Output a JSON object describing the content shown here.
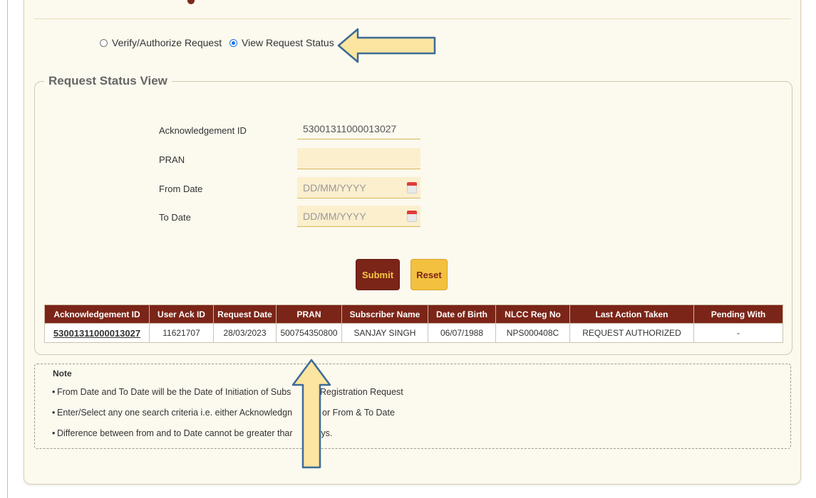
{
  "radio": {
    "options": [
      {
        "label": "Verify/Authorize Request",
        "selected": false
      },
      {
        "label": "View Request Status",
        "selected": true
      }
    ]
  },
  "section": {
    "title": "Request Status View"
  },
  "form": {
    "ack_id_label": "Acknowledgement ID",
    "ack_id_value": "53001311000013027",
    "pran_label": "PRAN",
    "pran_value": "",
    "from_date_label": "From Date",
    "from_date_placeholder": "DD/MM/YYYY",
    "to_date_label": "To Date",
    "to_date_placeholder": "DD/MM/YYYY",
    "calendar_icon": "calendar-icon"
  },
  "buttons": {
    "submit": "Submit",
    "reset": "Reset"
  },
  "table": {
    "headers": [
      "Acknowledgement ID",
      "User Ack ID",
      "Request Date",
      "PRAN",
      "Subscriber Name",
      "Date of Birth",
      "NLCC Reg No",
      "Last Action Taken",
      "Pending With"
    ],
    "rows": [
      [
        "53001311000013027",
        "11621707",
        "28/03/2023",
        "500754350800",
        "SANJAY SINGH",
        "06/07/1988",
        "NPS000408C",
        "REQUEST AUTHORIZED",
        "-"
      ]
    ]
  },
  "note": {
    "title": "Note",
    "items": [
      "From Date and To Date will be the Date of Initiation of Subs",
      "er Registration Request",
      "Enter/Select any one search criteria i.e. either Acknowledgn",
      "ID or From & To Date",
      "Difference between from and to Date cannot be greater thar",
      "days."
    ]
  },
  "colors": {
    "header_bg": "#7b2518",
    "accent_yellow": "#f3c03f",
    "arrow_fill": "#fbe5a0",
    "arrow_stroke": "#3d6a96"
  }
}
